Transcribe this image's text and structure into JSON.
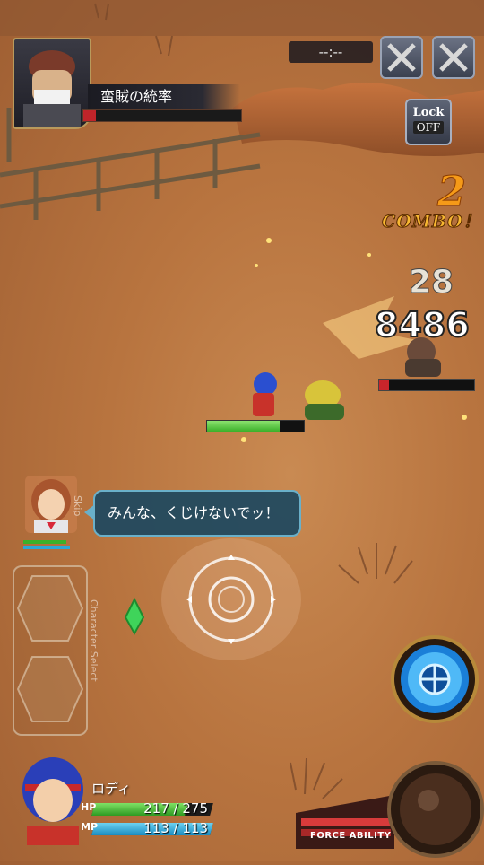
{
  "boss": {
    "name": "蛮賊の統率",
    "hp_fraction": 0.08
  },
  "timer": "--:--",
  "lock": {
    "label": "Lock",
    "state": "OFF"
  },
  "combo": {
    "count": "2",
    "label": "COMBO！"
  },
  "damage": {
    "small": "28",
    "big": "8486"
  },
  "enemy_hp_fraction": 0.1,
  "player_field_hp_fraction": 0.75,
  "speech": {
    "text": "みんな、くじけないでッ！",
    "side_label": "Skip"
  },
  "char_select_label": "Character Select",
  "player": {
    "name": "ロディ",
    "hp_label": "HP",
    "hp": "217 / 275",
    "hp_fraction": 0.79,
    "mp_label": "MP",
    "mp": "113 / 113",
    "mp_fraction": 1.0
  },
  "force_ability_label": "FORCE ABILITY",
  "colors": {
    "hp_green": "#3bb02a",
    "mp_blue": "#2aa8d8",
    "boss_red": "#c0242a",
    "combo_orange": "#f59a18"
  }
}
